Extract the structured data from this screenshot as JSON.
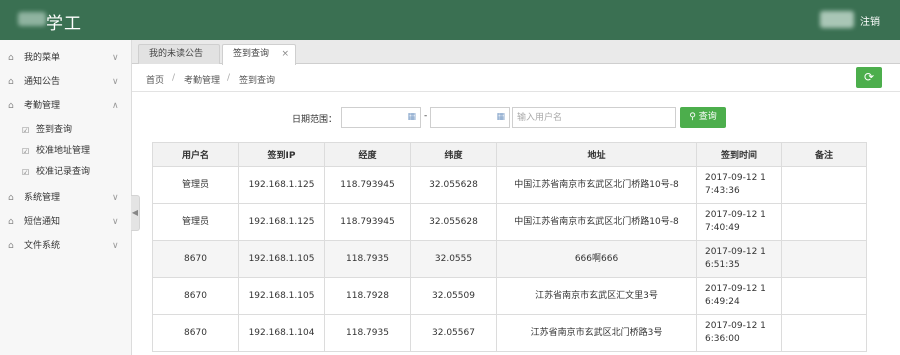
{
  "header": {
    "brand_suffix": "学工",
    "logout_label": "注销"
  },
  "sidebar": {
    "items": [
      {
        "label": "我的菜单",
        "icon": "home-icon",
        "expanded": false
      },
      {
        "label": "通知公告",
        "icon": "home-icon",
        "expanded": false
      },
      {
        "label": "考勤管理",
        "icon": "home-icon",
        "expanded": true
      },
      {
        "label": "系统管理",
        "icon": "home-icon",
        "expanded": false
      },
      {
        "label": "短信通知",
        "icon": "home-icon",
        "expanded": false
      },
      {
        "label": "文件系统",
        "icon": "home-icon",
        "expanded": false
      }
    ],
    "subitems": [
      {
        "label": "签到查询",
        "icon": "edit-icon"
      },
      {
        "label": "校准地址管理",
        "icon": "edit-icon"
      },
      {
        "label": "校准记录查询",
        "icon": "edit-icon"
      }
    ]
  },
  "tabs": [
    {
      "label": "我的未读公告",
      "active": false,
      "closable": false
    },
    {
      "label": "签到查询",
      "active": true,
      "closable": true,
      "close_glyph": "×"
    }
  ],
  "breadcrumb": [
    "首页",
    "考勤管理",
    "签到查询"
  ],
  "breadcrumb_separator": "/",
  "filter": {
    "date_label": "日期范围：",
    "date_separator": "-",
    "start_date": "",
    "end_date": "",
    "user_placeholder": "输入用户名",
    "user_value": "",
    "query_label": "查询"
  },
  "table": {
    "columns": [
      "用户名",
      "签到IP",
      "经度",
      "纬度",
      "地址",
      "签到时间",
      "备注"
    ],
    "rows": [
      [
        "管理员",
        "192.168.1.125",
        "118.793945",
        "32.055628",
        "中国江苏省南京市玄武区北门桥路10号-8",
        "2017-09-12 17:43:36",
        ""
      ],
      [
        "管理员",
        "192.168.1.125",
        "118.793945",
        "32.055628",
        "中国江苏省南京市玄武区北门桥路10号-8",
        "2017-09-12 17:40:49",
        ""
      ],
      [
        "8670",
        "192.168.1.105",
        "118.7935",
        "32.0555",
        "666啊666",
        "2017-09-12 16:51:35",
        ""
      ],
      [
        "8670",
        "192.168.1.105",
        "118.7928",
        "32.05509",
        "江苏省南京市玄武区汇文里3号",
        "2017-09-12 16:49:24",
        ""
      ],
      [
        "8670",
        "192.168.1.104",
        "118.7935",
        "32.05567",
        "江苏省南京市玄武区北门桥路3号",
        "2017-09-12 16:36:00",
        ""
      ]
    ]
  },
  "colors": {
    "header_bg": "#3a7052",
    "accent_green": "#4cae4c"
  }
}
